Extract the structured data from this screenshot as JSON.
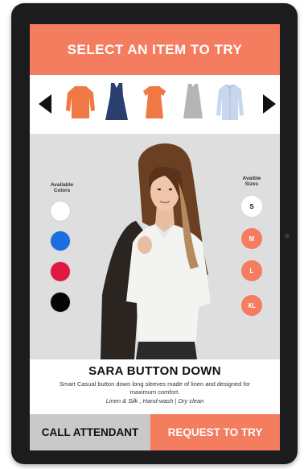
{
  "header": {
    "title": "SELECT AN ITEM TO TRY"
  },
  "carousel": {
    "prev_icon": "triangle-left",
    "next_icon": "triangle-right",
    "items": [
      {
        "name": "orange-long-sleeve-top",
        "color": "#f07845"
      },
      {
        "name": "navy-sleeveless-dress",
        "color": "#2a3f6e"
      },
      {
        "name": "orange-tee-dress",
        "color": "#f07845"
      },
      {
        "name": "grey-sleeveless-dress",
        "color": "#b5b5b5"
      },
      {
        "name": "light-blue-button-down",
        "color": "#c9d7ee"
      }
    ]
  },
  "colors": {
    "label": "Available Colors",
    "options": [
      "#ffffff",
      "#1a6fe0",
      "#e0183e",
      "#050505"
    ]
  },
  "sizes": {
    "label": "Avaible Sizes",
    "options": [
      "S",
      "M",
      "L",
      "XL"
    ],
    "selected": "S"
  },
  "product": {
    "name": "SARA BUTTON DOWN",
    "description": "Smart Casual button down long sleeves made of linen and designed for maximum comfort.",
    "material": "Linen & Silk , Hand-wash | Dry clean"
  },
  "actions": {
    "call_label": "CALL ATTENDANT",
    "request_label": "REQUEST TO TRY"
  },
  "theme": {
    "accent": "#f47c5f",
    "bezel": "#1c1c1e",
    "stage": "#dedede"
  }
}
